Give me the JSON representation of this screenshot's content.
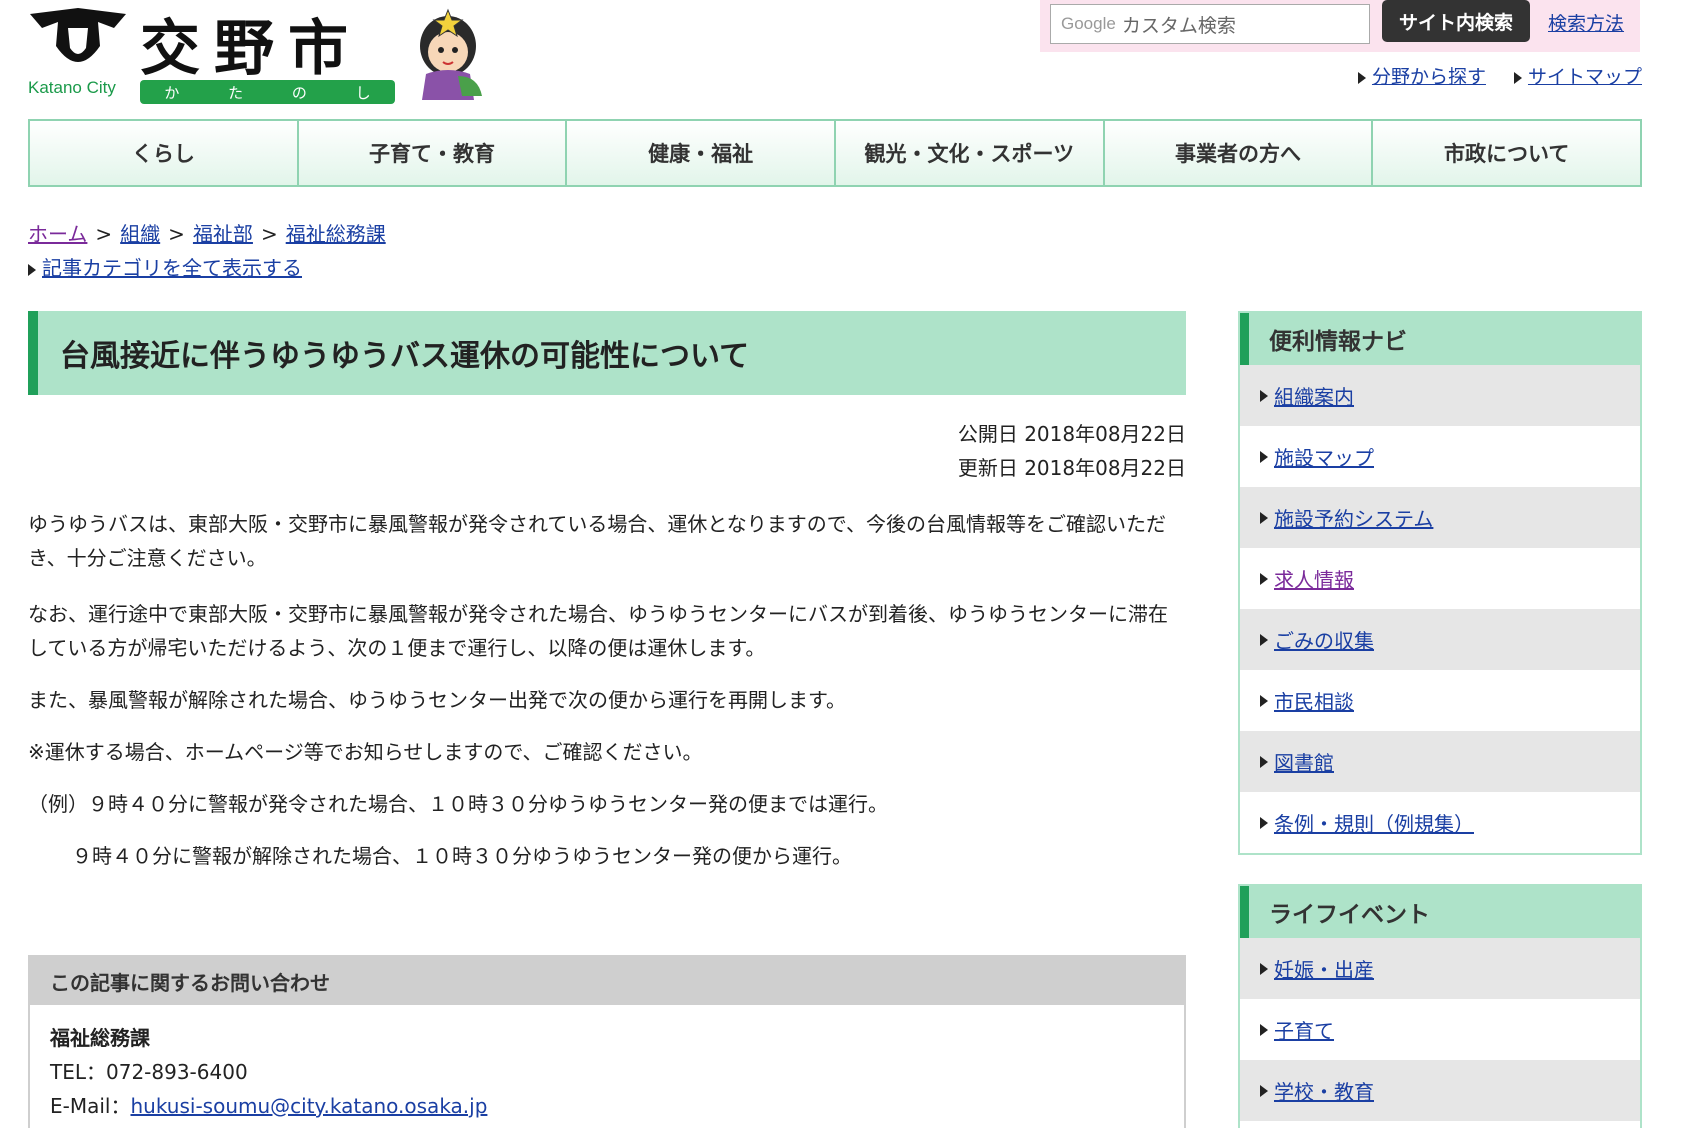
{
  "header": {
    "logo_title": "交野市",
    "logo_en": "Katano City",
    "logo_kana": [
      "か",
      "た",
      "の",
      "し"
    ],
    "search_brand": "Google",
    "search_placeholder": "カスタム検索",
    "search_button": "サイト内検索",
    "search_help": "検索方法",
    "links": [
      "分野から探す",
      "サイトマップ"
    ]
  },
  "nav": [
    "くらし",
    "子育て・教育",
    "健康・福祉",
    "観光・文化・スポーツ",
    "事業者の方へ",
    "市政について"
  ],
  "breadcrumb": [
    "ホーム",
    "組織",
    "福祉部",
    "福祉総務課"
  ],
  "breadcrumb_sep": ">",
  "category_link": "記事カテゴリを全て表示する",
  "article": {
    "title": "台風接近に伴うゆうゆうバス運休の可能性について",
    "published": "公開日 2018年08月22日",
    "updated": "更新日 2018年08月22日",
    "paragraphs": [
      "ゆうゆうバスは、東部大阪・交野市に暴風警報が発令されている場合、運休となりますので、今後の台風情報等をご確認いただき、十分ご注意ください。",
      "なお、運行途中で東部大阪・交野市に暴風警報が発令された場合、ゆうゆうセンターにバスが到着後、ゆうゆうセンターに滞在している方が帰宅いただけるよう、次の１便まで運行し、以降の便は運休します。",
      "また、暴風警報が解除された場合、ゆうゆうセンター出発で次の便から運行を再開します。",
      "※運休する場合、ホームページ等でお知らせしますので、ご確認ください。",
      "（例）９時４０分に警報が発令された場合、１０時３０分ゆうゆうセンター発の便までは運行。",
      "９時４０分に警報が解除された場合、１０時３０分ゆうゆうセンター発の便から運行。"
    ]
  },
  "contact": {
    "heading": "この記事に関するお問い合わせ",
    "dept": "福祉総務課",
    "tel": "TEL：072-893-6400",
    "email_label": "E-Mail：",
    "email": "hukusi-soumu@city.katano.osaka.jp"
  },
  "sidebar": {
    "nav_title": "便利情報ナビ",
    "nav_items": [
      "組織案内",
      "施設マップ",
      "施設予約システム",
      "求人情報",
      "ごみの収集",
      "市民相談",
      "図書館",
      "条例・規則（例規集）"
    ],
    "life_title": "ライフイベント",
    "life_items": [
      "妊娠・出産",
      "子育て",
      "学校・教育"
    ]
  },
  "colors": {
    "accent_green": "#20a05a",
    "light_green": "#aee3c9",
    "link": "#1a3fa3",
    "visited": "#7a2a9a"
  }
}
